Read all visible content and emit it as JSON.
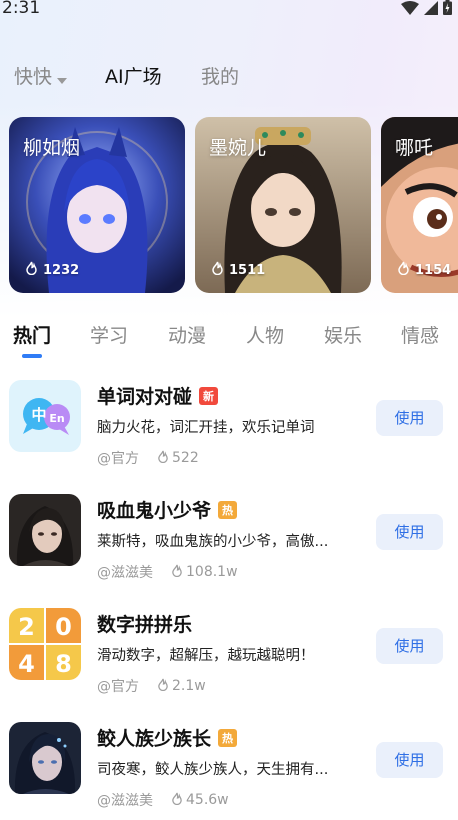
{
  "status_bar": {
    "time": "2:31"
  },
  "top_tabs": [
    {
      "label": "快快",
      "active": false
    },
    {
      "label": "AI广场",
      "active": true
    },
    {
      "label": "我的",
      "active": false
    }
  ],
  "featured": [
    {
      "name": "柳如烟",
      "count": "1232"
    },
    {
      "name": "墨婉儿",
      "count": "1511"
    },
    {
      "name": "哪吒",
      "count": "1154"
    }
  ],
  "categories": [
    {
      "label": "热门",
      "active": true
    },
    {
      "label": "学习",
      "active": false
    },
    {
      "label": "动漫",
      "active": false
    },
    {
      "label": "人物",
      "active": false
    },
    {
      "label": "娱乐",
      "active": false
    },
    {
      "label": "情感",
      "active": false
    }
  ],
  "items": [
    {
      "title": "单词对对碰",
      "badge": "新",
      "badge_type": "new",
      "desc": "脑力火花，词汇开挂，欢乐记单词",
      "author": "@官方",
      "uses": "522",
      "button": "使用",
      "thumb_icon": "chat-bubbles-icon"
    },
    {
      "title": "吸血鬼小少爷",
      "badge": "热",
      "badge_type": "hot",
      "desc": "莱斯特，吸血鬼族的小少爷，高傲...",
      "author": "@滋滋美",
      "uses": "108.1w",
      "button": "使用",
      "thumb_icon": "portrait-icon"
    },
    {
      "title": "数字拼拼乐",
      "badge": "",
      "badge_type": "",
      "desc": "滑动数字，超解压，越玩越聪明！",
      "author": "@官方",
      "uses": "2.1w",
      "button": "使用",
      "thumb_icon": "2048-tile-icon"
    },
    {
      "title": "鲛人族少族长",
      "badge": "热",
      "badge_type": "hot",
      "desc": "司夜寒，鲛人族少族人，天生拥有...",
      "author": "@滋滋美",
      "uses": "45.6w",
      "button": "使用",
      "thumb_icon": "portrait-icon"
    }
  ],
  "tiles_2048": [
    "2",
    "0",
    "4",
    "8"
  ],
  "thumb_1_labels": [
    "中",
    "En"
  ],
  "colors": {
    "accent": "#2f7cf6",
    "button_bg": "#eaf0fb",
    "badge_new": "#f1493c",
    "badge_hot": "#f3a93a"
  }
}
